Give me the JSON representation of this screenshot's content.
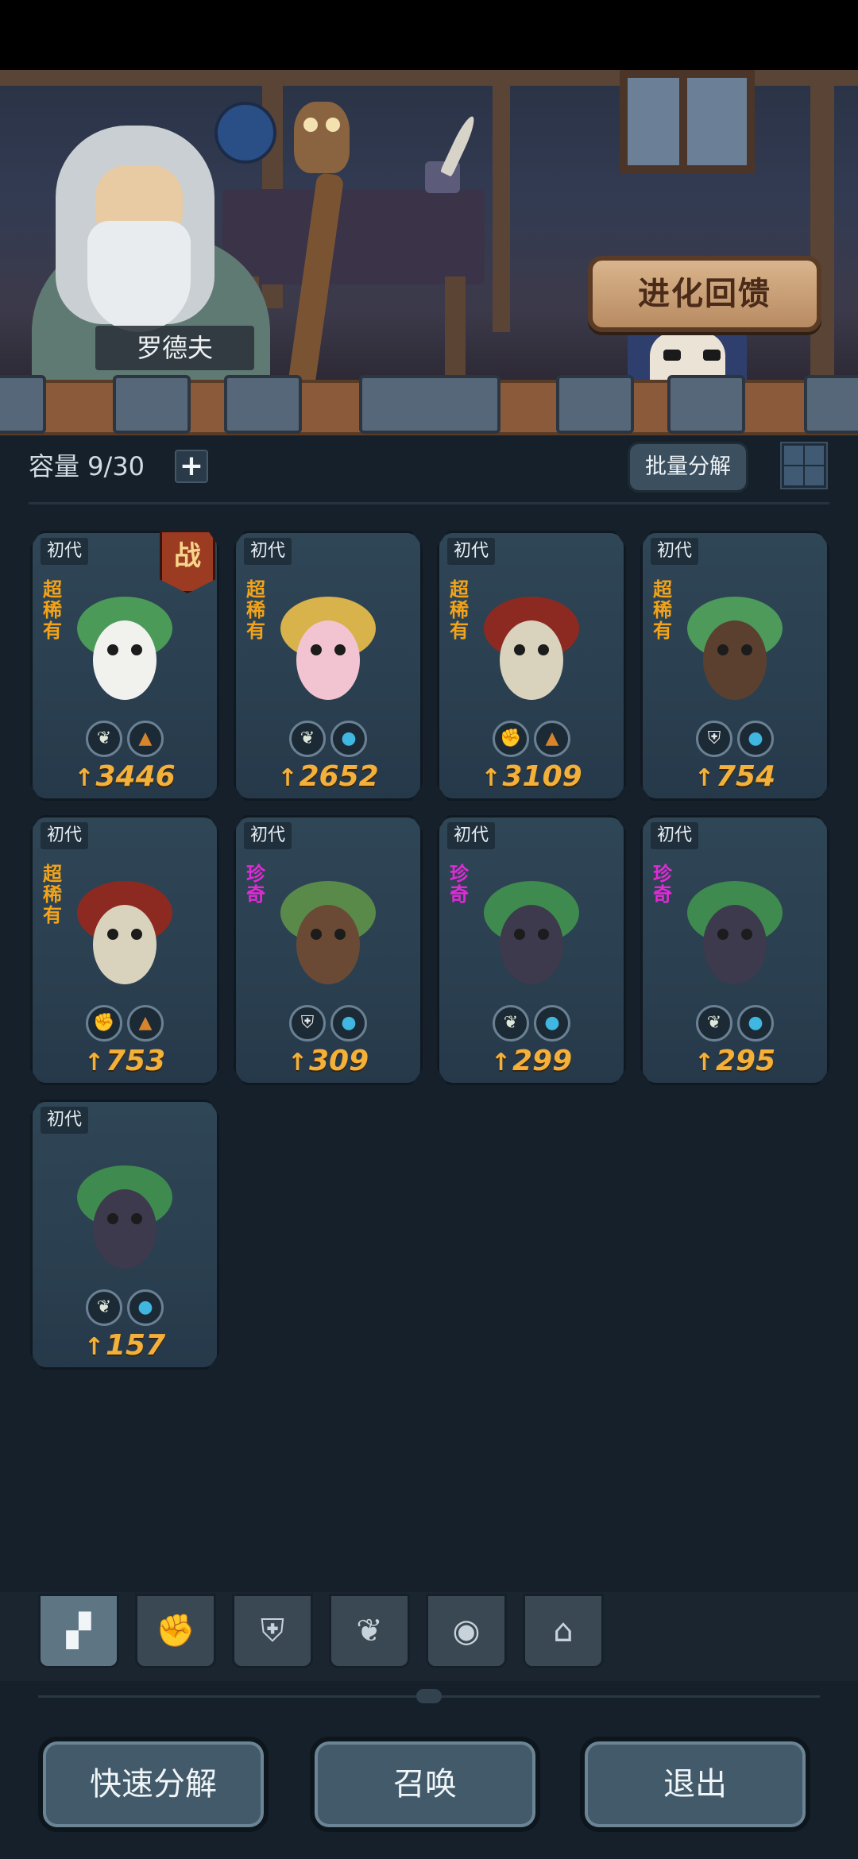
{
  "banner": {
    "npc_name": "罗德夫",
    "evolution_button_label": "进化回馈"
  },
  "inventory": {
    "capacity_label": "容量 9/30",
    "add_capacity_icon": "plus-icon",
    "batch_decompose_label": "批量分解",
    "grid_view_icon": "grid-icon"
  },
  "cards": [
    {
      "gen": "初代",
      "rarity": "超稀有",
      "rarity_class": "super",
      "battle": "战",
      "power": "3446",
      "types": [
        "sprout",
        "rock"
      ]
    },
    {
      "gen": "初代",
      "rarity": "超稀有",
      "rarity_class": "super",
      "battle": "",
      "power": "2652",
      "types": [
        "sprout",
        "water"
      ]
    },
    {
      "gen": "初代",
      "rarity": "超稀有",
      "rarity_class": "super",
      "battle": "",
      "power": "3109",
      "types": [
        "fist",
        "rock"
      ]
    },
    {
      "gen": "初代",
      "rarity": "超稀有",
      "rarity_class": "super",
      "battle": "",
      "power": "754",
      "types": [
        "shield",
        "water"
      ]
    },
    {
      "gen": "初代",
      "rarity": "超稀有",
      "rarity_class": "super",
      "battle": "",
      "power": "753",
      "types": [
        "fist",
        "rock"
      ]
    },
    {
      "gen": "初代",
      "rarity": "珍奇",
      "rarity_class": "rare",
      "battle": "",
      "power": "309",
      "types": [
        "shield",
        "water"
      ]
    },
    {
      "gen": "初代",
      "rarity": "珍奇",
      "rarity_class": "rare",
      "battle": "",
      "power": "299",
      "types": [
        "sprout",
        "water"
      ]
    },
    {
      "gen": "初代",
      "rarity": "珍奇",
      "rarity_class": "rare",
      "battle": "",
      "power": "295",
      "types": [
        "sprout",
        "water"
      ]
    },
    {
      "gen": "初代",
      "rarity": "",
      "rarity_class": "",
      "battle": "",
      "power": "157",
      "types": [
        "sprout",
        "water"
      ]
    }
  ],
  "filter_tabs": [
    {
      "icon": "all-blocks-icon",
      "active": true
    },
    {
      "icon": "fist-icon",
      "active": false
    },
    {
      "icon": "shield-icon",
      "active": false
    },
    {
      "icon": "sprout-icon",
      "active": false
    },
    {
      "icon": "alien-head-icon",
      "active": false
    },
    {
      "icon": "helmet-icon",
      "active": false
    }
  ],
  "actions": {
    "quick_decompose": "快速分解",
    "summon": "召唤",
    "exit": "退出"
  },
  "colors": {
    "background": "#16202a",
    "super_rare": "#f2a31a",
    "rare": "#e12ad8",
    "power": "#f3b03a"
  }
}
